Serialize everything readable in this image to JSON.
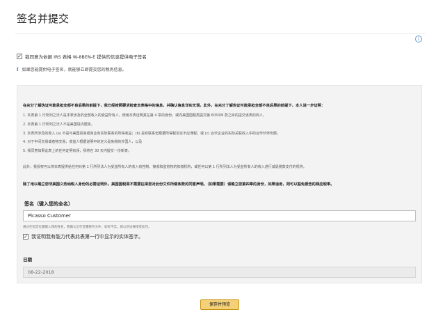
{
  "page": {
    "title": "签名并提交"
  },
  "consent": {
    "checkbox_mark": "✓",
    "label": "我同意为依据 IRS 表格 W-8BEN-E 提供的信息提供电子签名"
  },
  "note": {
    "icon": "i",
    "text": "如果您能提供电子签名，就能够立即提交您的税务信息。"
  },
  "certification": {
    "lead": "在充分了解伪证可能承担全部不良后果的前提下，我已经按照要求检查本表格中的信息，并确认信息详实无误。此外，在充分了解伪证可能承担全部不良后果的前提下，本人进一步证明：",
    "items": [
      "1. 本表第 1 行所列之法人是本表涉及的全部收入的受益所有人，使用本表证明其在第 4 章的身份，或向美国国税局提交第 6050W 款之目的提交该表的商人，",
      "2. 本表第 1 行所列之法人不是美国境内居民，",
      "3. 本表所涉及的收入 (a) 不是与美国贸易或商业有实际联系的所得收益；(b) 是有联系但根据所得税协定不应课税；或 (c) 合伙企业的实际关联收入中的合作伙伴份额，",
      "4. 对于中间交易或者物交易，收益人根据说明中的定义是免税的外国人，以及",
      "5. 我同意如果此表上的任何证明有误，我将在 30 天内提交一份新表。"
    ],
    "after": "此外，我授权可以将本表提供给任何对第 1 行所列法人为受益所有人的收入有控制、接收和监管权的扣缴机构，或任何以第 1 行所列法人为受益所有人的收入进行减退税款支付的机构。",
    "warning": "除了用以确立您非美国义务纳税人身份的必需证明外，美国国税局不需要征得您对此份文件所载条款的同意声明。（如果需要）请确立您第四章的身份，如果适用，则可以豁免报告的相应税率。"
  },
  "signature": {
    "label": "签名（键入您的全名）",
    "value": "Picasso Customer",
    "help": "通过在指定位置输入我的姓名，我确认正在签署税务文件，如有不实，即以伪证罪接受处罚。",
    "capacity_label": "我证明我有能力代表此表第一行中显示的实体签字。"
  },
  "date": {
    "label": "日期",
    "value": "08-22-2018"
  },
  "actions": {
    "save_preview": "保存并预览"
  },
  "colors": {
    "button_bg": "#f4d078",
    "button_border": "#c89411",
    "panel_bg": "#f3f3f3",
    "info_icon": "#6a9ad0",
    "note_icon": "#3a7bc8"
  }
}
